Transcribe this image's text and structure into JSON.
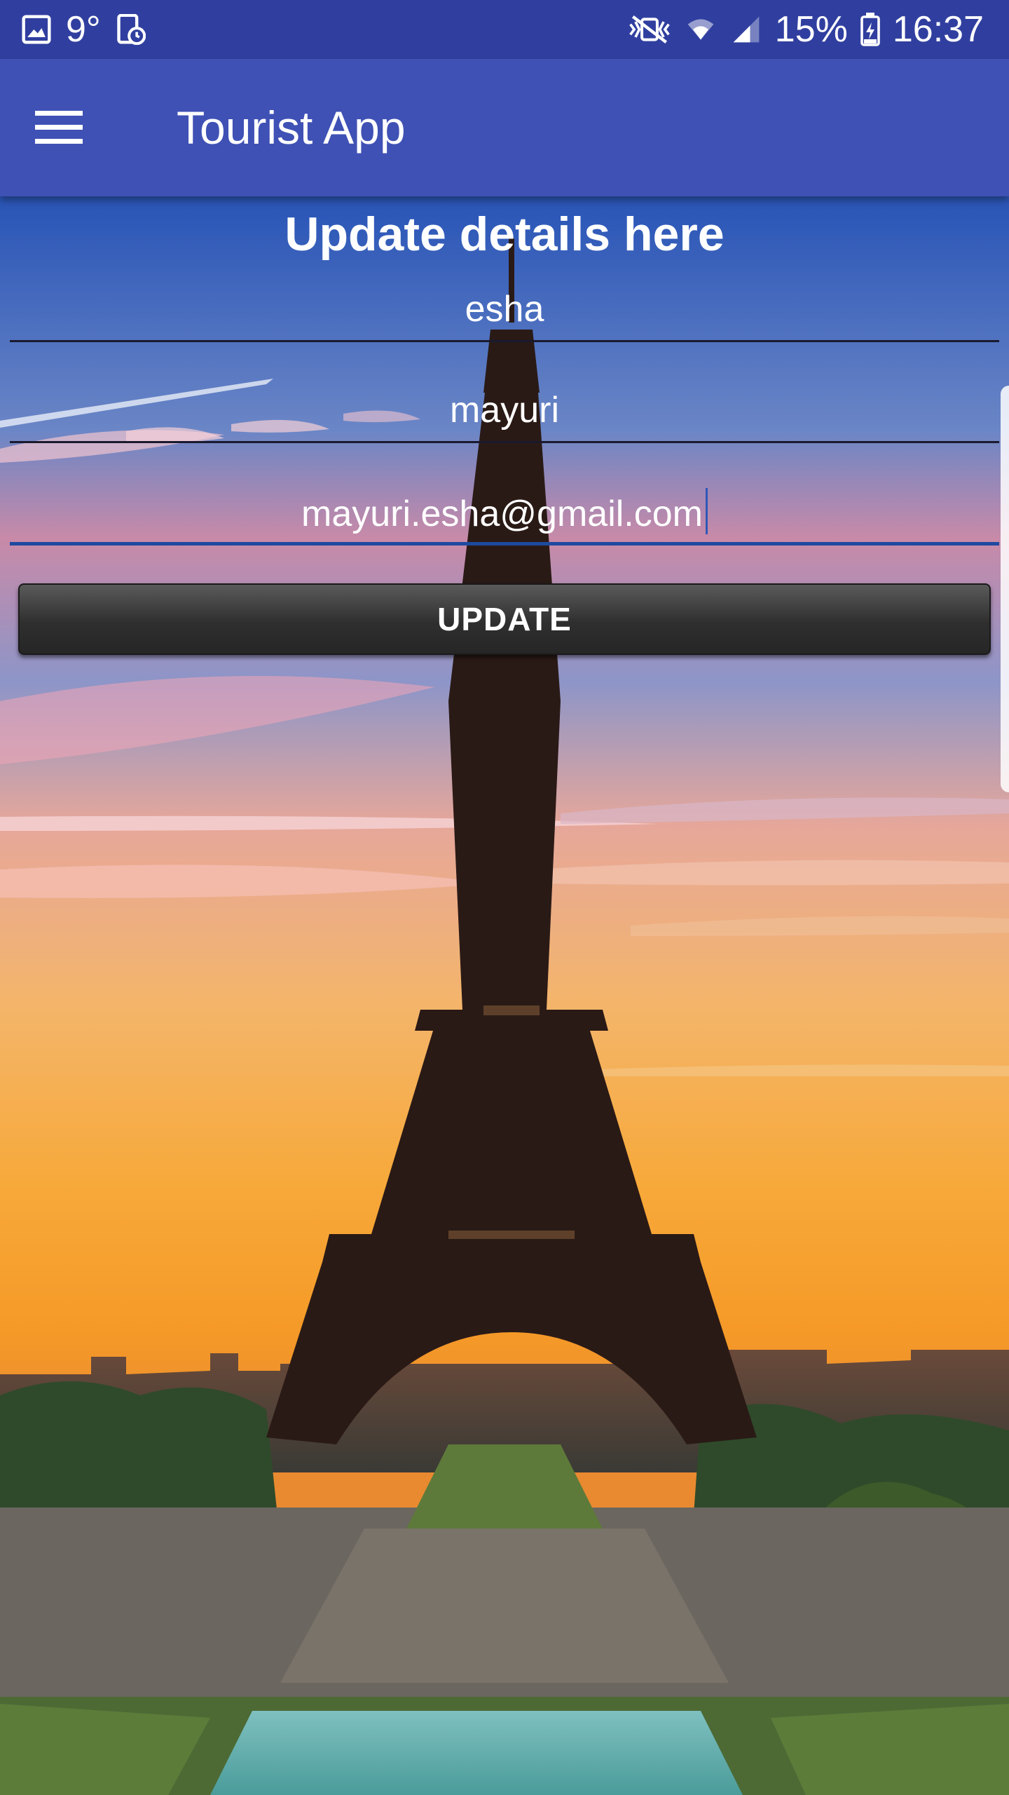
{
  "status_bar": {
    "temperature": "9°",
    "battery": "15%",
    "time": "16:37",
    "icons": [
      "gallery-icon",
      "screenshot-schedule-icon",
      "vibrate-mute-icon",
      "wifi-icon",
      "signal-icon",
      "battery-icon"
    ]
  },
  "app_bar": {
    "title": "Tourist App",
    "menu_icon": "hamburger-menu-icon"
  },
  "form": {
    "heading": "Update details here",
    "first_name": "esha",
    "last_name": "mayuri",
    "email": "mayuri.esha@gmail.com",
    "update_label": "UPDATE"
  },
  "background": {
    "description_icon": "eiffel-tower-sunset-image"
  },
  "colors": {
    "status_bar": "#303f9f",
    "app_bar": "#3f51b5",
    "focus_underline": "#1e4aa0",
    "button": "#2f2f2f"
  }
}
